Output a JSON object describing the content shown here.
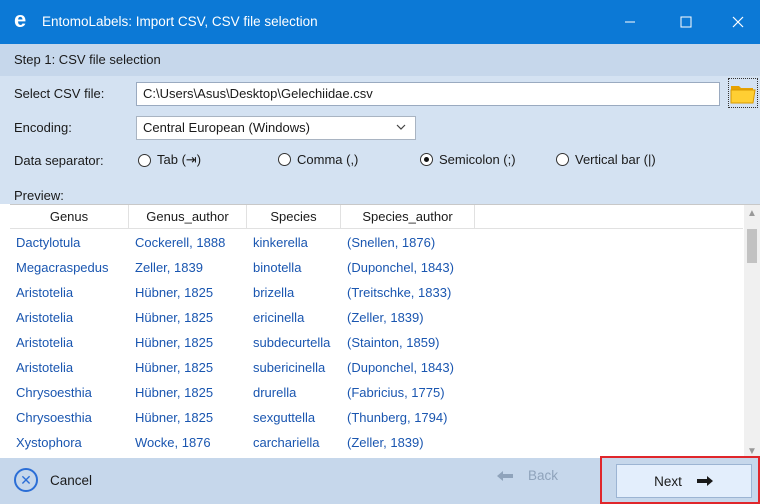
{
  "window": {
    "title": "EntomoLabels: Import CSV, CSV file selection",
    "app_icon_glyph": "e"
  },
  "step": {
    "label": "Step 1: CSV file selection"
  },
  "form": {
    "file_label": "Select CSV file:",
    "file_value": "C:\\Users\\Asus\\Desktop\\Gelechiidae.csv",
    "encoding_label": "Encoding:",
    "encoding_value": "Central European (Windows)",
    "separator_label": "Data separator:",
    "separators": [
      {
        "label": "Tab (⇥)",
        "selected": false
      },
      {
        "label": "Comma (,)",
        "selected": false
      },
      {
        "label": "Semicolon (;)",
        "selected": true
      },
      {
        "label": "Vertical bar (|)",
        "selected": false
      }
    ],
    "preview_label": "Preview:"
  },
  "grid": {
    "columns": [
      "Genus",
      "Genus_author",
      "Species",
      "Species_author"
    ],
    "rows": [
      [
        "Dactylotula",
        "Cockerell, 1888",
        "kinkerella",
        "(Snellen, 1876)"
      ],
      [
        "Megacraspedus",
        "Zeller, 1839",
        "binotella",
        "(Duponchel, 1843)"
      ],
      [
        "Aristotelia",
        "Hübner, 1825",
        "brizella",
        "(Treitschke, 1833)"
      ],
      [
        "Aristotelia",
        "Hübner, 1825",
        "ericinella",
        "(Zeller, 1839)"
      ],
      [
        "Aristotelia",
        "Hübner, 1825",
        "subdecurtella",
        "(Stainton, 1859)"
      ],
      [
        "Aristotelia",
        "Hübner, 1825",
        "subericinella",
        "(Duponchel, 1843)"
      ],
      [
        "Chrysoesthia",
        "Hübner, 1825",
        "drurella",
        "(Fabricius, 1775)"
      ],
      [
        "Chrysoesthia",
        "Hübner, 1825",
        "sexguttella",
        "(Thunberg, 1794)"
      ],
      [
        "Xystophora",
        "Wocke, 1876",
        "carchariella",
        "(Zeller, 1839)"
      ]
    ]
  },
  "footer": {
    "cancel_label": "Cancel",
    "back_label": "Back",
    "next_label": "Next"
  },
  "colors": {
    "titlebar": "#0c79d6",
    "panel": "#d4e2f2",
    "link_text": "#1a56b0",
    "highlight": "#e0262b"
  }
}
